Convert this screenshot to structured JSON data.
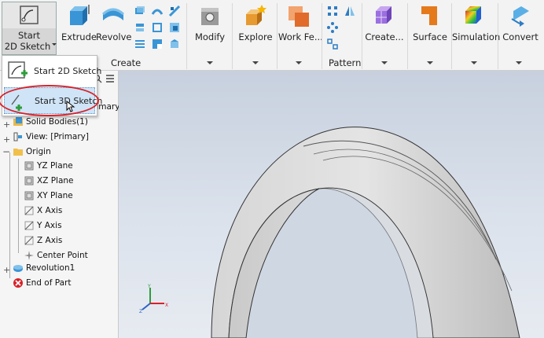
{
  "ribbon": {
    "start_2d_label_1": "Start",
    "start_2d_label_2": "2D Sketch",
    "extrude": "Extrude",
    "revolve": "Revolve",
    "create_group": "Create",
    "modify": "Modify",
    "explore": "Explore",
    "work_features": "Work Fe...",
    "pattern_group": "Pattern",
    "create_freeform": "Create...",
    "surface": "Surface",
    "simulation": "Simulation",
    "convert": "Convert"
  },
  "dropdown": {
    "item1": "Start 2D Sketch",
    "item2": "Start 3D Sketch"
  },
  "browser": {
    "partial_label": "rimary]",
    "items": [
      {
        "label": "Solid Bodies(1)"
      },
      {
        "label": "View: [Primary]"
      },
      {
        "label": "Origin"
      },
      {
        "label": "YZ Plane"
      },
      {
        "label": "XZ Plane"
      },
      {
        "label": "XY Plane"
      },
      {
        "label": "X Axis"
      },
      {
        "label": "Y Axis"
      },
      {
        "label": "Z Axis"
      },
      {
        "label": "Center Point"
      },
      {
        "label": "Revolution1"
      },
      {
        "label": "End of Part"
      }
    ]
  },
  "colors": {
    "accent": "#2e7cc4",
    "highlight": "#d8222a",
    "model": "#d9d9d9"
  }
}
